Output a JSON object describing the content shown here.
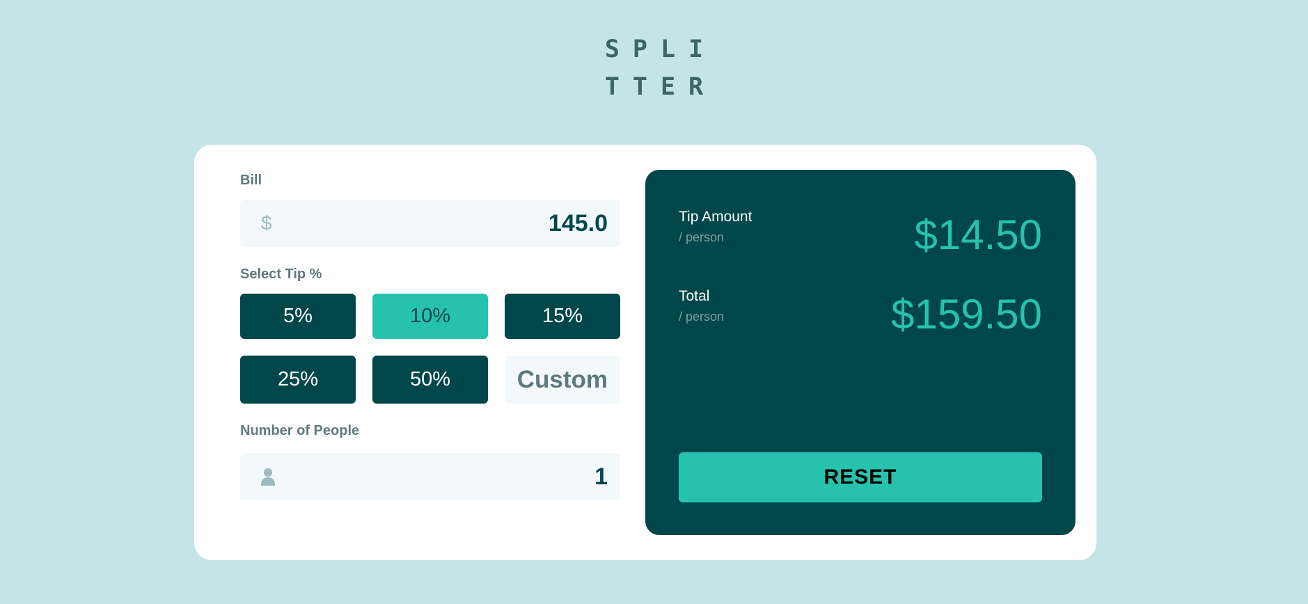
{
  "header": {
    "logo_line1": "SPLI",
    "logo_line2": "TTER"
  },
  "form": {
    "bill_label": "Bill",
    "bill_icon": "$",
    "bill_value": "145.0",
    "tip_label": "Select Tip %",
    "tips": [
      "5%",
      "10%",
      "15%",
      "25%",
      "50%"
    ],
    "active_tip": "10%",
    "custom_placeholder": "Custom",
    "people_label": "Number of People",
    "people_icon": "person-icon",
    "people_value": "1"
  },
  "result": {
    "tip_name": "Tip Amount",
    "tip_sub": "/ person",
    "tip_value": "$14.50",
    "total_name": "Total",
    "total_sub": "/ person",
    "total_value": "$159.50",
    "reset_label": "RESET"
  },
  "colors": {
    "background": "#c5e4e7",
    "dark_cyan": "#00474b",
    "accent": "#26c2ae",
    "input_bg": "#f3f9fa"
  }
}
